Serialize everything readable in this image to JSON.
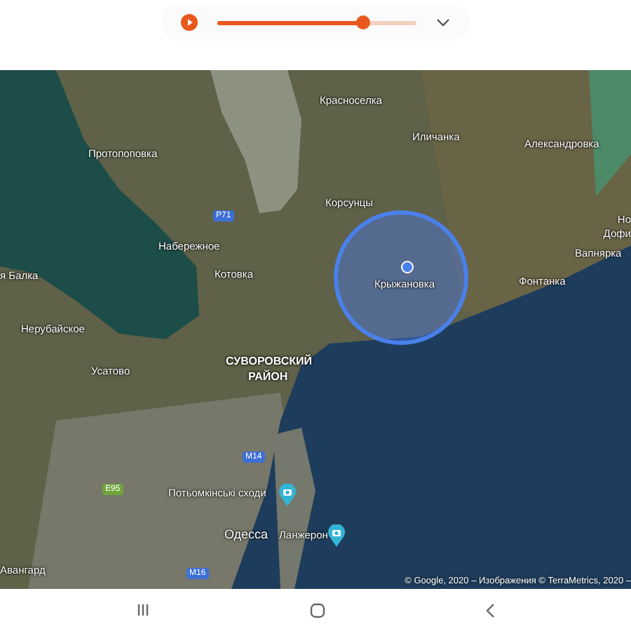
{
  "player": {
    "level": 0.73
  },
  "map": {
    "labels": [
      {
        "text": "Протопоповка",
        "kind": "place"
      },
      {
        "text": "Набережное",
        "kind": "place"
      },
      {
        "text": "Котовка",
        "kind": "place"
      },
      {
        "text": "я Балка",
        "kind": "place"
      },
      {
        "text": "Нерубайское",
        "kind": "place"
      },
      {
        "text": "Усатово",
        "kind": "place"
      },
      {
        "text": "Красноселка",
        "kind": "place"
      },
      {
        "text": "Иличанка",
        "kind": "place"
      },
      {
        "text": "Александровка",
        "kind": "place"
      },
      {
        "text": "Корсунцы",
        "kind": "place"
      },
      {
        "text": "Крыжановка",
        "kind": "place"
      },
      {
        "text": "Вапнярка",
        "kind": "place"
      },
      {
        "text": "Фонтанка",
        "kind": "place"
      },
      {
        "text": "Но",
        "kind": "place"
      },
      {
        "text": "Дофи",
        "kind": "place"
      },
      {
        "text": "СУВОРОВСКИЙ",
        "kind": "district"
      },
      {
        "text": "РАЙОН",
        "kind": "district"
      },
      {
        "text": "Потьомкінські сходи",
        "kind": "place"
      },
      {
        "text": "Одесса",
        "kind": "city"
      },
      {
        "text": "Ланжерон",
        "kind": "place"
      },
      {
        "text": "Авангард",
        "kind": "place"
      },
      {
        "text": "P71",
        "kind": "road-blue"
      },
      {
        "text": "M14",
        "kind": "road-blue"
      },
      {
        "text": "E95",
        "kind": "road-green"
      },
      {
        "text": "M16",
        "kind": "road-blue"
      }
    ],
    "attribution": "© Google, 2020 – Изображения © TerraMetrics, 2020 –"
  }
}
